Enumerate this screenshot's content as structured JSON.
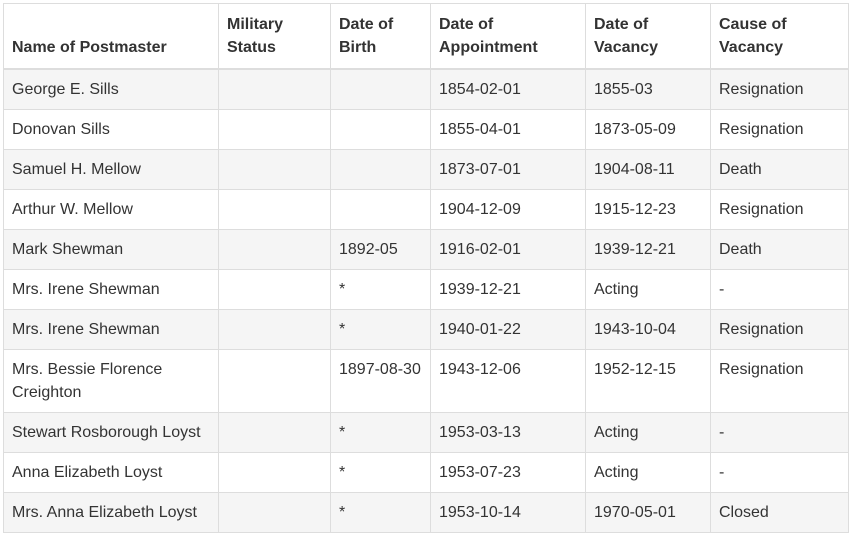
{
  "table": {
    "headers": [
      "Name of Postmaster",
      "Military Status",
      "Date of Birth",
      "Date of Appointment",
      "Date of Vacancy",
      "Cause of Vacancy"
    ],
    "rows": [
      [
        "George E. Sills",
        "",
        "",
        "1854-02-01",
        "1855-03",
        "Resignation"
      ],
      [
        "Donovan Sills",
        "",
        "",
        "1855-04-01",
        "1873-05-09",
        "Resignation"
      ],
      [
        "Samuel H. Mellow",
        "",
        "",
        "1873-07-01",
        "1904-08-11",
        "Death"
      ],
      [
        "Arthur W. Mellow",
        "",
        "",
        "1904-12-09",
        "1915-12-23",
        "Resignation"
      ],
      [
        "Mark Shewman",
        "",
        "1892-05",
        "1916-02-01",
        "1939-12-21",
        "Death"
      ],
      [
        "Mrs. Irene Shewman",
        "",
        "*",
        "1939-12-21",
        "Acting",
        "-"
      ],
      [
        "Mrs. Irene Shewman",
        "",
        "*",
        "1940-01-22",
        "1943-10-04",
        "Resignation"
      ],
      [
        "Mrs. Bessie Florence Creighton",
        "",
        "1897-08-30",
        "1943-12-06",
        "1952-12-15",
        "Resignation"
      ],
      [
        "Stewart Rosborough Loyst",
        "",
        "*",
        "1953-03-13",
        "Acting",
        "-"
      ],
      [
        "Anna Elizabeth Loyst",
        "",
        "*",
        "1953-07-23",
        "Acting",
        "-"
      ],
      [
        "Mrs. Anna Elizabeth Loyst",
        "",
        "*",
        "1953-10-14",
        "1970-05-01",
        "Closed"
      ]
    ]
  }
}
